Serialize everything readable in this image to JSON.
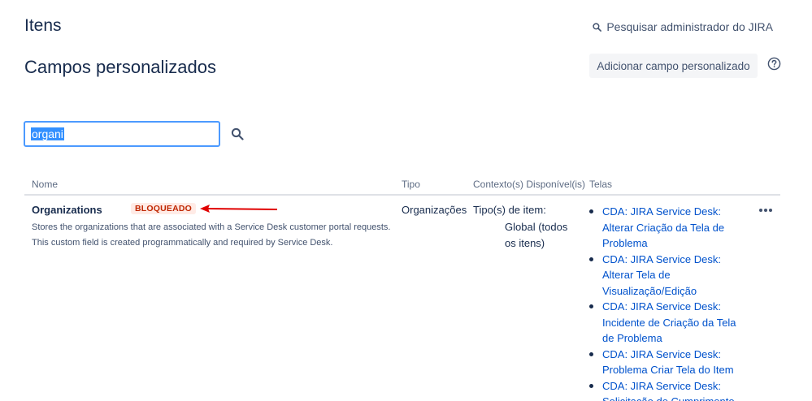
{
  "header": {
    "section_title": "Itens",
    "admin_search_label": "Pesquisar administrador do JIRA",
    "page_title": "Campos personalizados",
    "add_button_label": "Adicionar campo personalizado"
  },
  "search": {
    "value": "organi"
  },
  "table": {
    "columns": [
      "Nome",
      "Tipo",
      "Contexto(s) Disponível(is)",
      "Telas"
    ],
    "rows": [
      {
        "name": "Organizations",
        "badge": "BLOQUEADO",
        "description": "Stores the organizations that are associated with a Service Desk customer portal requests. This custom field is created programmatically and required by Service Desk.",
        "type": "Organizações",
        "context_label": "Tipo(s) de item:",
        "context_value": "Global (todos os itens)",
        "screens": [
          "CDA: JIRA Service Desk: Alterar Criação da Tela de Problema",
          "CDA: JIRA Service Desk: Alterar Tela de Visualização/Edição",
          "CDA: JIRA Service Desk: Incidente de Criação da Tela de Problema",
          "CDA: JIRA Service Desk: Problema Criar Tela do Item",
          "CDA: JIRA Service Desk: Solicitação de Cumprimento"
        ]
      }
    ]
  },
  "colors": {
    "link": "#0052cc",
    "badge_text": "#bf2600",
    "badge_bg": "#ffebe6",
    "focus": "#4c9aff",
    "annotation_arrow": "#e00000"
  },
  "icons": [
    "search-icon",
    "help-icon",
    "more-icon",
    "arrow-annotation"
  ]
}
